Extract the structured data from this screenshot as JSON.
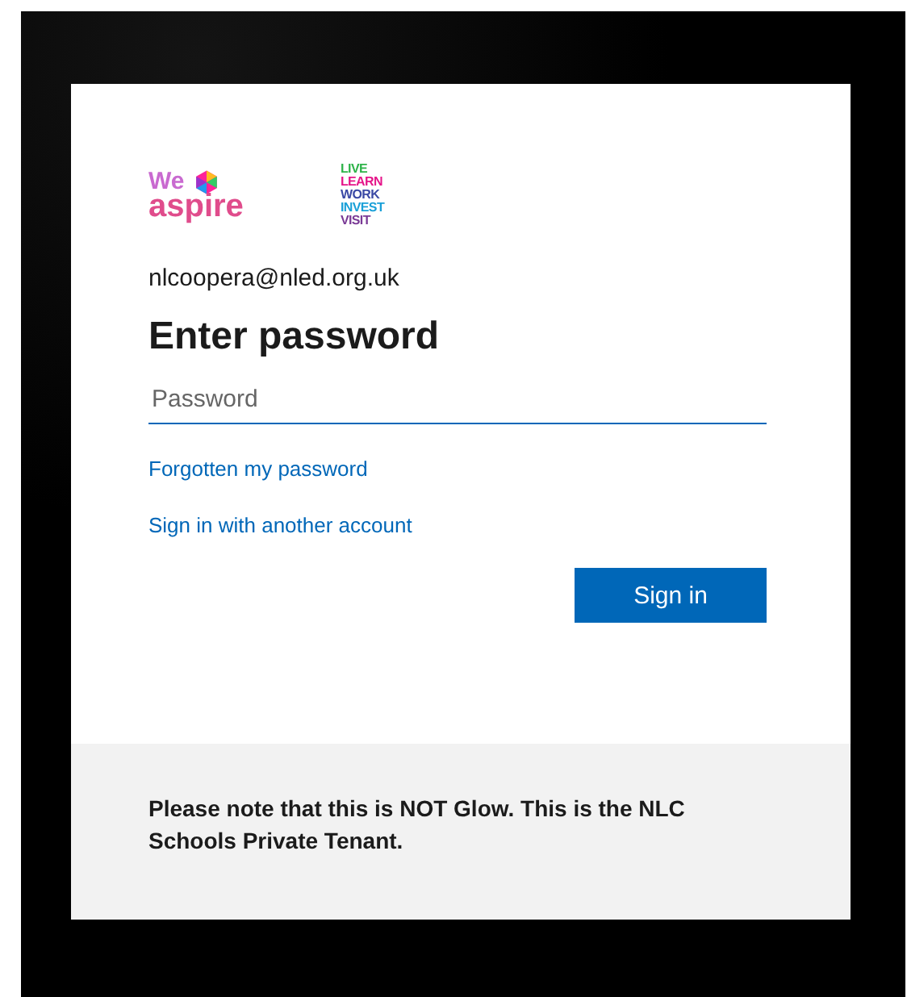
{
  "logos": {
    "brand": {
      "top": "We",
      "bottom": "aspire"
    },
    "tagline": [
      "LIVE",
      "LEARN",
      "WORK",
      "INVEST",
      "VISIT"
    ]
  },
  "account": "nlcoopera@nled.org.uk",
  "title": "Enter password",
  "password": {
    "placeholder": "Password"
  },
  "links": [
    "Forgotten my password",
    "Sign in with another account"
  ],
  "button": "Sign in",
  "footer": "Please note that this is NOT Glow. This is the NLC Schools Private Tenant."
}
